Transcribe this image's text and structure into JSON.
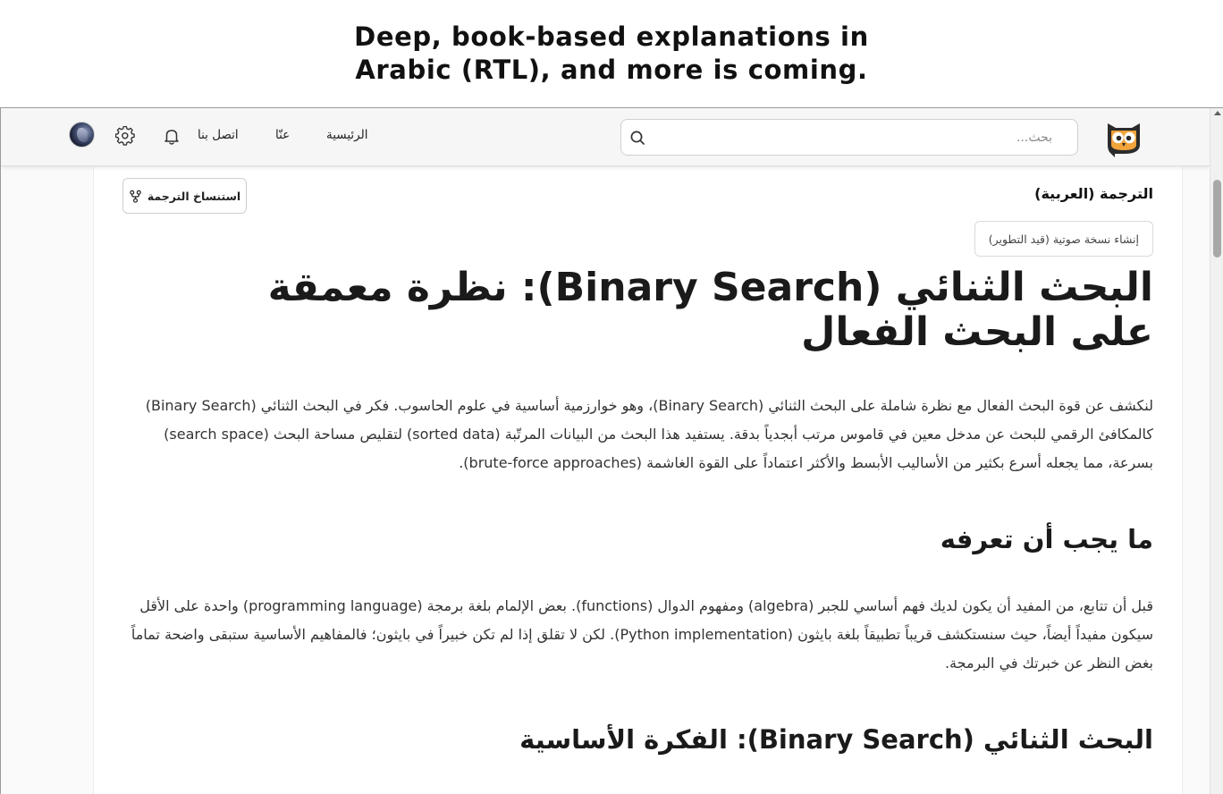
{
  "banner": {
    "text": "Deep, book-based explanations in Arabic (RTL), and more is coming."
  },
  "navbar": {
    "search_placeholder": "بحث...",
    "links": {
      "home": "الرئيسية",
      "about": "عنّا",
      "contact": "اتصل بنا"
    },
    "icons": [
      "owl-logo-icon",
      "search-icon",
      "bell-icon",
      "gear-icon"
    ]
  },
  "article": {
    "translation_label": "الترجمة (العربية)",
    "copy_translation_button": "استنساخ الترجمة",
    "audio_button": "إنشاء نسخة صوتية (قيد التطوير)",
    "title": "البحث الثنائي (Binary Search): نظرة معمقة على البحث الفعال",
    "intro": "لنكشف عن قوة البحث الفعال مع نظرة شاملة على البحث الثنائي (Binary Search)، وهو خوارزمية أساسية في علوم الحاسوب. فكر في البحث الثنائي (Binary Search) كالمكافئ الرقمي للبحث عن مدخل معين في قاموس مرتب أبجدياً بدقة. يستفيد هذا البحث من البيانات المرتّبة (sorted data) لتقليص مساحة البحث (search space) بسرعة، مما يجعله أسرع بكثير من الأساليب الأبسط والأكثر اعتماداً على القوة الغاشمة (brute-force approaches).",
    "section1_heading": "ما يجب أن تعرفه",
    "section1_text": "قبل أن تتابع، من المفيد أن يكون لديك فهم أساسي للجبر (algebra) ومفهوم الدوال (functions). بعض الإلمام بلغة برمجة (programming language) واحدة على الأقل سيكون مفيداً أيضاً، حيث سنستكشف قريباً تطبيقاً بلغة بايثون (Python implementation). لكن لا تقلق إذا لم تكن خبيراً في بايثون؛ فالمفاهيم الأساسية ستبقى واضحة تماماً بغض النظر عن خبرتك في البرمجة.",
    "section2_heading": "البحث الثنائي (Binary Search): الفكرة الأساسية"
  },
  "colors": {
    "navbar_bg": "#f6f6f7",
    "owl_orange": "#f2a33a",
    "text": "#1a1a1a"
  }
}
